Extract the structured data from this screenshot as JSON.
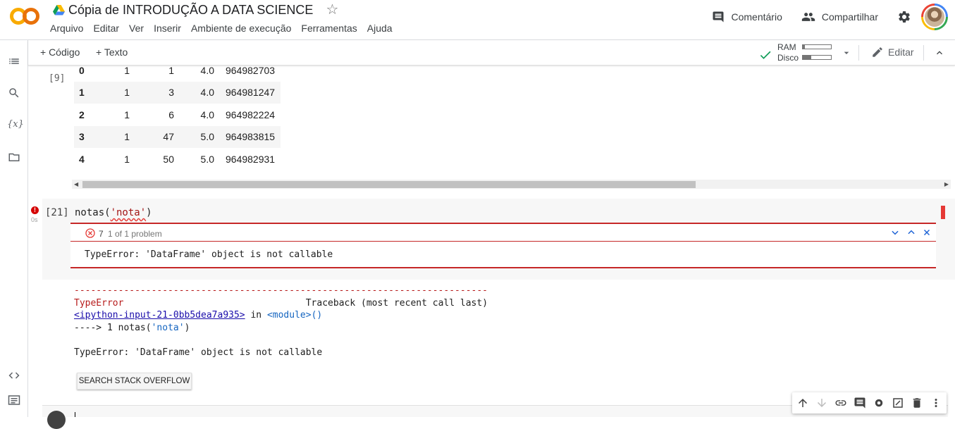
{
  "header": {
    "doc_title": "Cópia de INTRODUÇÃO A DATA SCIENCE",
    "menu": [
      "Arquivo",
      "Editar",
      "Ver",
      "Inserir",
      "Ambiente de execução",
      "Ferramentas",
      "Ajuda"
    ],
    "comment_label": "Comentário",
    "share_label": "Compartilhar"
  },
  "toolbar": {
    "add_code": "+ Código",
    "add_text": "+ Texto",
    "ram_label": "RAM",
    "disk_label": "Disco",
    "ram_usage": 0.08,
    "disk_usage": 0.3,
    "edit_label": "Editar"
  },
  "left_rail": {
    "icons": [
      "toc-icon",
      "search-icon",
      "variables-icon",
      "files-icon",
      "code-snippets-icon",
      "terminal-icon"
    ],
    "variables_glyph": "{x}"
  },
  "output_cell": {
    "exec_count": "[9]",
    "rows": [
      [
        "0",
        "1",
        "1",
        "4.0",
        "964982703"
      ],
      [
        "1",
        "1",
        "3",
        "4.0",
        "964981247"
      ],
      [
        "2",
        "1",
        "6",
        "4.0",
        "964982224"
      ],
      [
        "3",
        "1",
        "47",
        "5.0",
        "964983815"
      ],
      [
        "4",
        "1",
        "50",
        "5.0",
        "964982931"
      ]
    ]
  },
  "error_cell": {
    "exec_count": "[21]",
    "exec_time": "0s",
    "status_glyph": "!",
    "code_fn": "notas(",
    "code_arg": "'nota'",
    "code_close": ")",
    "peek_count": "7",
    "peek_problem": "1 of 1 problem",
    "peek_message": "TypeError: 'DataFrame' object is not callable"
  },
  "traceback": {
    "rule": "---------------------------------------------------------------------------",
    "err_name": "TypeError",
    "traceback_label": "Traceback (most recent call last)",
    "input_link": "<ipython-input-21-0bb5dea7a935>",
    "in_word": " in ",
    "module": "<module>()",
    "arrow": "----> 1 ",
    "line_code": "notas(",
    "line_arg": "'nota'",
    "line_close": ")",
    "error_line": "TypeError: 'DataFrame' object is not callable",
    "so_button": "SEARCH STACK OVERFLOW"
  }
}
